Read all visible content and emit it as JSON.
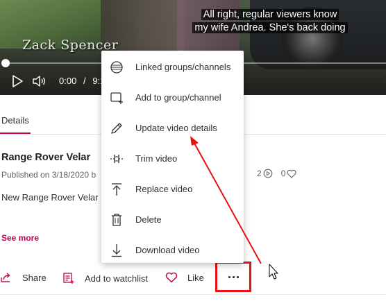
{
  "video": {
    "watermark": "Zack Spencer",
    "caption_line1": "All right, regular viewers know",
    "caption_line2": "my wife Andrea. She's back doing",
    "time_current": "0:00",
    "time_separator": "/",
    "time_total": "9:1",
    "progress": 0
  },
  "details": {
    "tab_label": "Details",
    "title": "Range Rover Velar",
    "published": "Published on 3/18/2020 b",
    "description": "New Range Rover Velar",
    "see_more": "See more",
    "views_count": "2",
    "likes_count": "0"
  },
  "actions": {
    "share": "Share",
    "watchlist": "Add to watchlist",
    "like": "Like"
  },
  "menu": {
    "items": [
      {
        "label": "Linked groups/channels",
        "icon": "globe-icon"
      },
      {
        "label": "Add to group/channel",
        "icon": "add-to-group-icon"
      },
      {
        "label": "Update video details",
        "icon": "pencil-icon"
      },
      {
        "label": "Trim video",
        "icon": "trim-icon"
      },
      {
        "label": "Replace video",
        "icon": "replace-icon"
      },
      {
        "label": "Delete",
        "icon": "trash-icon"
      },
      {
        "label": "Download video",
        "icon": "download-icon"
      }
    ]
  },
  "colors": {
    "accent": "#c30052",
    "annotation": "#e81010"
  }
}
